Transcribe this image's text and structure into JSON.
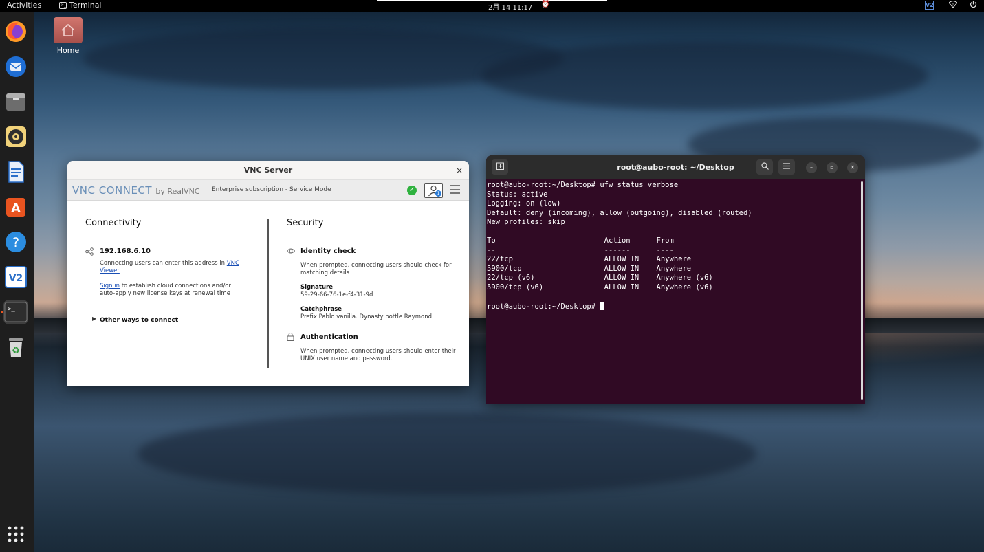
{
  "topbar": {
    "activities": "Activities",
    "app_name": "Terminal",
    "clock": "2月 14  11:17"
  },
  "desktop": {
    "home_label": "Home"
  },
  "dock": {
    "items": [
      "firefox-icon",
      "thunderbird-icon",
      "files-icon",
      "rhythmbox-icon",
      "writer-icon",
      "app-center-icon",
      "help-icon",
      "vnc-icon",
      "terminal-icon",
      "trash-icon",
      "show-apps-icon"
    ]
  },
  "vnc": {
    "title": "VNC Server",
    "close": "×",
    "logo_main": "VNC CONNECT",
    "logo_by": "by RealVNC",
    "subscription": "Enterprise subscription - Service Mode",
    "user_badge": "1",
    "connectivity": {
      "heading": "Connectivity",
      "ip": "192.168.6.10",
      "ip_desc_prefix": "Connecting users can enter this address in ",
      "ip_desc_link": "VNC Viewer",
      "signin_link": "Sign in",
      "signin_text_1": " to establish cloud connections and/or",
      "signin_text_2": "auto-apply new license keys at renewal time",
      "other_ways": "Other ways to connect"
    },
    "security": {
      "heading": "Security",
      "identity_heading": "Identity check",
      "identity_desc_1": "When prompted, connecting users should check for",
      "identity_desc_2": "matching details",
      "signature_label": "Signature",
      "signature_value": "59-29-66-76-1e-f4-31-9d",
      "catchphrase_label": "Catchphrase",
      "catchphrase_value": "Prefix Pablo vanilla. Dynasty bottle Raymond",
      "auth_heading": "Authentication",
      "auth_desc_1": "When prompted, connecting users should enter their",
      "auth_desc_2": "UNIX user name and password."
    }
  },
  "terminal": {
    "title": "root@aubo-root: ~/Desktop",
    "lines": [
      "root@aubo-root:~/Desktop# ufw status verbose",
      "Status: active",
      "Logging: on (low)",
      "Default: deny (incoming), allow (outgoing), disabled (routed)",
      "New profiles: skip",
      "",
      "To                         Action      From",
      "--                         ------      ----",
      "22/tcp                     ALLOW IN    Anywhere",
      "5900/tcp                   ALLOW IN    Anywhere",
      "22/tcp (v6)                ALLOW IN    Anywhere (v6)",
      "5900/tcp (v6)              ALLOW IN    Anywhere (v6)",
      ""
    ],
    "prompt": "root@aubo-root:~/Desktop# "
  }
}
